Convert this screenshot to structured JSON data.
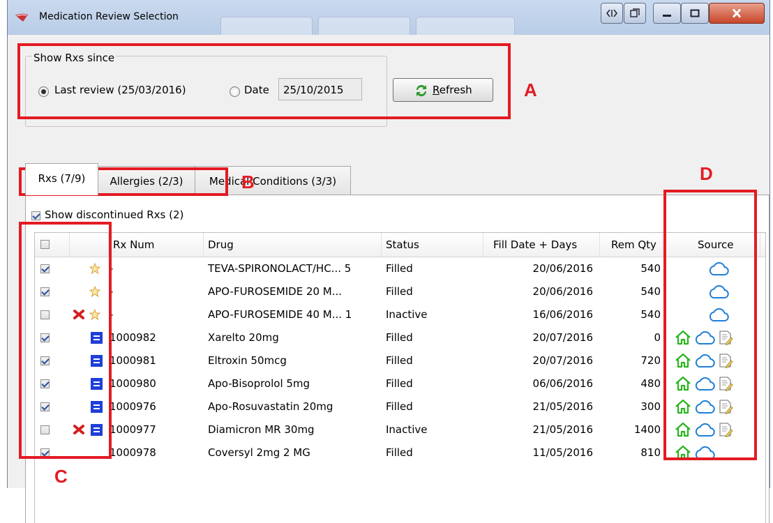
{
  "window": {
    "title": "Medication Review Selection",
    "ghost_tabs": [
      "",
      "",
      ""
    ]
  },
  "filter": {
    "group_title": "Show Rxs since",
    "last_review_label": "Last review (25/03/2016)",
    "last_review_selected": true,
    "date_label": "Date",
    "date_value": "25/10/2015",
    "refresh_label": "Refresh",
    "refresh_mnemonic": "R"
  },
  "tabs": [
    {
      "label": "Rxs (7/9)",
      "active": true
    },
    {
      "label": "Allergies (2/3)",
      "active": false
    },
    {
      "label": "Medical Conditions (3/3)",
      "active": false
    }
  ],
  "show_discontinued": {
    "label": "Show discontinued Rxs (2)",
    "checked": true
  },
  "table": {
    "columns": [
      "",
      "",
      "Rx Num",
      "Drug",
      "Status",
      "Fill Date + Days",
      "Rem Qty",
      "Source"
    ],
    "rows": [
      {
        "checked": true,
        "discontinued": false,
        "star": true,
        "local": false,
        "rx_num": "-",
        "drug": "TEVA-SPIRONOLACT/HC... 5",
        "status": "Filled",
        "fill_date": "20/06/2016",
        "rem_qty": "540",
        "sources": [
          "cloud-icon"
        ]
      },
      {
        "checked": true,
        "discontinued": false,
        "star": true,
        "local": false,
        "rx_num": "-",
        "drug": "APO-FUROSEMIDE 20 M...",
        "status": "Filled",
        "fill_date": "20/06/2016",
        "rem_qty": "540",
        "sources": [
          "cloud-icon"
        ]
      },
      {
        "checked": false,
        "discontinued": true,
        "star": true,
        "local": false,
        "rx_num": "-",
        "drug": "APO-FUROSEMIDE 40 M... 1",
        "status": "Inactive",
        "fill_date": "16/06/2016",
        "rem_qty": "540",
        "sources": [
          "cloud-icon"
        ]
      },
      {
        "checked": true,
        "discontinued": false,
        "star": false,
        "local": true,
        "rx_num": "1000982",
        "drug": "Xarelto 20mg",
        "status": "Filled",
        "fill_date": "20/07/2016",
        "rem_qty": "0",
        "sources": [
          "home-icon",
          "cloud-icon",
          "note-icon"
        ]
      },
      {
        "checked": true,
        "discontinued": false,
        "star": false,
        "local": true,
        "rx_num": "1000981",
        "drug": "Eltroxin 50mcg",
        "status": "Filled",
        "fill_date": "20/07/2016",
        "rem_qty": "720",
        "sources": [
          "home-icon",
          "cloud-icon",
          "note-icon"
        ]
      },
      {
        "checked": true,
        "discontinued": false,
        "star": false,
        "local": true,
        "rx_num": "1000980",
        "drug": "Apo-Bisoprolol 5mg",
        "status": "Filled",
        "fill_date": "06/06/2016",
        "rem_qty": "480",
        "sources": [
          "home-icon",
          "cloud-icon",
          "note-icon"
        ]
      },
      {
        "checked": true,
        "discontinued": false,
        "star": false,
        "local": true,
        "rx_num": "1000976",
        "drug": "Apo-Rosuvastatin 20mg",
        "status": "Filled",
        "fill_date": "21/05/2016",
        "rem_qty": "300",
        "sources": [
          "home-icon",
          "cloud-icon",
          "note-icon"
        ]
      },
      {
        "checked": false,
        "discontinued": true,
        "star": false,
        "local": true,
        "rx_num": "1000977",
        "drug": "Diamicron MR 30mg",
        "status": "Inactive",
        "fill_date": "21/05/2016",
        "rem_qty": "1400",
        "sources": [
          "home-icon",
          "cloud-icon",
          "note-icon"
        ]
      },
      {
        "checked": true,
        "discontinued": false,
        "star": false,
        "local": false,
        "rx_num": "1000978",
        "drug": "Coversyl 2mg 2 MG",
        "status": "Filled",
        "fill_date": "11/05/2016",
        "rem_qty": "810",
        "sources": [
          "home-icon",
          "cloud-icon"
        ]
      }
    ]
  },
  "annotations": [
    {
      "letter": "A",
      "color": "#e31b23"
    },
    {
      "letter": "B",
      "color": "#e31b23"
    },
    {
      "letter": "C",
      "color": "#e31b23"
    },
    {
      "letter": "D",
      "color": "#e31b23"
    }
  ],
  "colors": {
    "annotation": "#e31b23",
    "cloud": "#1e7fd6",
    "home": "#29b51f",
    "local_rx": "#1f3fd8",
    "discontinued": "#d42020",
    "star": "#f2c14e"
  }
}
